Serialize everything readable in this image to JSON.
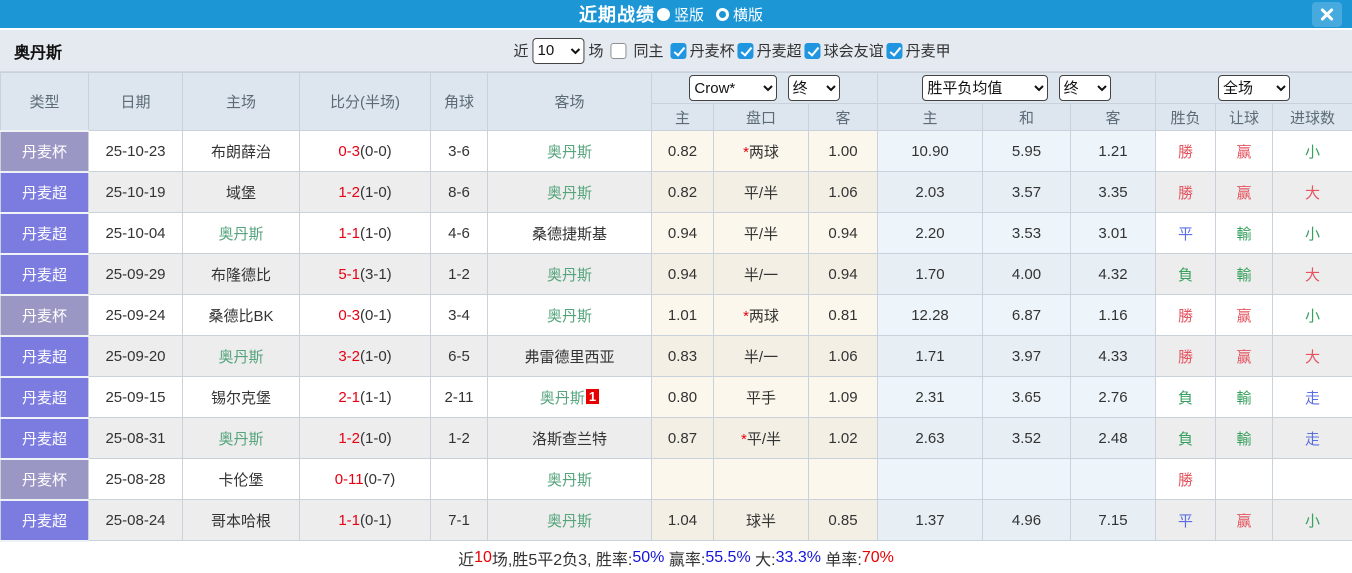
{
  "titlebar": {
    "title": "近期战绩",
    "view_options": [
      {
        "label": "竖版",
        "selected": true
      },
      {
        "label": "横版",
        "selected": false
      }
    ]
  },
  "filters": {
    "team": "奥丹斯",
    "recent_label": "近",
    "count_value": "10",
    "matches_label": "场",
    "same_home": {
      "label": "同主",
      "checked": false
    },
    "leagues": [
      {
        "label": "丹麦杯",
        "checked": true
      },
      {
        "label": "丹麦超",
        "checked": true
      },
      {
        "label": "球会友谊",
        "checked": true
      },
      {
        "label": "丹麦甲",
        "checked": true
      }
    ]
  },
  "controls": {
    "bookmaker": "Crow*",
    "bookmaker_state": "终",
    "europe": "胜平负均值",
    "europe_state": "终",
    "scope": "全场"
  },
  "table": {
    "headers": {
      "main": [
        "类型",
        "日期",
        "主场",
        "比分(半场)",
        "角球",
        "客场"
      ],
      "sub": [
        "主",
        "盘口",
        "客",
        "主",
        "和",
        "客",
        "胜负",
        "让球",
        "进球数"
      ]
    },
    "rows": [
      {
        "league": "丹麦杯",
        "league_type": "cup",
        "date": "25-10-23",
        "home": {
          "name": "布朗薛治",
          "self": false
        },
        "score_main": "0-3",
        "score_half": "(0-0)",
        "corner": "3-6",
        "away": {
          "name": "奥丹斯",
          "self": true
        },
        "asia": {
          "home": "0.82",
          "line": "两球",
          "star": true,
          "away": "1.00"
        },
        "euro": {
          "home": "10.90",
          "draw": "5.95",
          "away": "1.21"
        },
        "res": [
          {
            "t": "勝",
            "c": "red"
          },
          {
            "t": "赢",
            "c": "red"
          },
          {
            "t": "小",
            "c": "green"
          }
        ]
      },
      {
        "league": "丹麦超",
        "league_type": "super",
        "date": "25-10-19",
        "home": {
          "name": "域堡",
          "self": false
        },
        "score_main": "1-2",
        "score_half": "(1-0)",
        "corner": "8-6",
        "away": {
          "name": "奥丹斯",
          "self": true
        },
        "asia": {
          "home": "0.82",
          "line": "平/半",
          "star": false,
          "away": "1.06"
        },
        "euro": {
          "home": "2.03",
          "draw": "3.57",
          "away": "3.35"
        },
        "res": [
          {
            "t": "勝",
            "c": "red"
          },
          {
            "t": "赢",
            "c": "red"
          },
          {
            "t": "大",
            "c": "red"
          }
        ]
      },
      {
        "league": "丹麦超",
        "league_type": "super",
        "date": "25-10-04",
        "home": {
          "name": "奥丹斯",
          "self": true
        },
        "score_main": "1-1",
        "score_half": "(1-0)",
        "corner": "4-6",
        "away": {
          "name": "桑德捷斯基",
          "self": false
        },
        "asia": {
          "home": "0.94",
          "line": "平/半",
          "star": false,
          "away": "0.94"
        },
        "euro": {
          "home": "2.20",
          "draw": "3.53",
          "away": "3.01"
        },
        "res": [
          {
            "t": "平",
            "c": "blue"
          },
          {
            "t": "輸",
            "c": "green"
          },
          {
            "t": "小",
            "c": "green"
          }
        ]
      },
      {
        "league": "丹麦超",
        "league_type": "super",
        "date": "25-09-29",
        "home": {
          "name": "布隆德比",
          "self": false
        },
        "score_main": "5-1",
        "score_half": "(3-1)",
        "corner": "1-2",
        "away": {
          "name": "奥丹斯",
          "self": true
        },
        "asia": {
          "home": "0.94",
          "line": "半/一",
          "star": false,
          "away": "0.94"
        },
        "euro": {
          "home": "1.70",
          "draw": "4.00",
          "away": "4.32"
        },
        "res": [
          {
            "t": "負",
            "c": "green"
          },
          {
            "t": "輸",
            "c": "green"
          },
          {
            "t": "大",
            "c": "red"
          }
        ]
      },
      {
        "league": "丹麦杯",
        "league_type": "cup",
        "date": "25-09-24",
        "home": {
          "name": "桑德比BK",
          "self": false
        },
        "score_main": "0-3",
        "score_half": "(0-1)",
        "corner": "3-4",
        "away": {
          "name": "奥丹斯",
          "self": true
        },
        "asia": {
          "home": "1.01",
          "line": "两球",
          "star": true,
          "away": "0.81"
        },
        "euro": {
          "home": "12.28",
          "draw": "6.87",
          "away": "1.16"
        },
        "res": [
          {
            "t": "勝",
            "c": "red"
          },
          {
            "t": "赢",
            "c": "red"
          },
          {
            "t": "小",
            "c": "green"
          }
        ]
      },
      {
        "league": "丹麦超",
        "league_type": "super",
        "date": "25-09-20",
        "home": {
          "name": "奥丹斯",
          "self": true
        },
        "score_main": "3-2",
        "score_half": "(1-0)",
        "corner": "6-5",
        "away": {
          "name": "弗雷德里西亚",
          "self": false
        },
        "asia": {
          "home": "0.83",
          "line": "半/一",
          "star": false,
          "away": "1.06"
        },
        "euro": {
          "home": "1.71",
          "draw": "3.97",
          "away": "4.33"
        },
        "res": [
          {
            "t": "勝",
            "c": "red"
          },
          {
            "t": "赢",
            "c": "red"
          },
          {
            "t": "大",
            "c": "red"
          }
        ]
      },
      {
        "league": "丹麦超",
        "league_type": "super",
        "date": "25-09-15",
        "home": {
          "name": "锡尔克堡",
          "self": false
        },
        "score_main": "2-1",
        "score_half": "(1-1)",
        "corner": "2-11",
        "away": {
          "name": "奥丹斯",
          "self": true,
          "badge": "1"
        },
        "asia": {
          "home": "0.80",
          "line": "平手",
          "star": false,
          "away": "1.09"
        },
        "euro": {
          "home": "2.31",
          "draw": "3.65",
          "away": "2.76"
        },
        "res": [
          {
            "t": "負",
            "c": "green"
          },
          {
            "t": "輸",
            "c": "green"
          },
          {
            "t": "走",
            "c": "blue"
          }
        ]
      },
      {
        "league": "丹麦超",
        "league_type": "super",
        "date": "25-08-31",
        "home": {
          "name": "奥丹斯",
          "self": true
        },
        "score_main": "1-2",
        "score_half": "(1-0)",
        "corner": "1-2",
        "away": {
          "name": "洛斯查兰特",
          "self": false
        },
        "asia": {
          "home": "0.87",
          "line": "平/半",
          "star": true,
          "away": "1.02"
        },
        "euro": {
          "home": "2.63",
          "draw": "3.52",
          "away": "2.48"
        },
        "res": [
          {
            "t": "負",
            "c": "green"
          },
          {
            "t": "輸",
            "c": "green"
          },
          {
            "t": "走",
            "c": "blue"
          }
        ]
      },
      {
        "league": "丹麦杯",
        "league_type": "cup",
        "date": "25-08-28",
        "home": {
          "name": "卡伦堡",
          "self": false
        },
        "score_main": "0-11",
        "score_half": "(0-7)",
        "corner": "",
        "away": {
          "name": "奥丹斯",
          "self": true
        },
        "asia": {
          "home": "",
          "line": "",
          "star": false,
          "away": ""
        },
        "euro": {
          "home": "",
          "draw": "",
          "away": ""
        },
        "res": [
          {
            "t": "勝",
            "c": "red"
          },
          {
            "t": "",
            "c": "red"
          },
          {
            "t": "",
            "c": "red"
          }
        ]
      },
      {
        "league": "丹麦超",
        "league_type": "super",
        "date": "25-08-24",
        "home": {
          "name": "哥本哈根",
          "self": false
        },
        "score_main": "1-1",
        "score_half": "(0-1)",
        "corner": "7-1",
        "away": {
          "name": "奥丹斯",
          "self": true
        },
        "asia": {
          "home": "1.04",
          "line": "球半",
          "star": false,
          "away": "0.85"
        },
        "euro": {
          "home": "1.37",
          "draw": "4.96",
          "away": "7.15"
        },
        "res": [
          {
            "t": "平",
            "c": "blue"
          },
          {
            "t": "赢",
            "c": "red"
          },
          {
            "t": "小",
            "c": "green"
          }
        ]
      }
    ]
  },
  "summary": {
    "segments": [
      {
        "t": "近",
        "c": "dark"
      },
      {
        "t": "10",
        "c": "red"
      },
      {
        "t": "场,胜5平2负3, 胜率:",
        "c": "dark"
      },
      {
        "t": "50%",
        "c": "blue"
      },
      {
        "t": " 赢率:",
        "c": "dark"
      },
      {
        "t": "55.5%",
        "c": "blue"
      },
      {
        "t": " 大:",
        "c": "dark"
      },
      {
        "t": "33.3%",
        "c": "blue"
      },
      {
        "t": " 单率:",
        "c": "dark"
      },
      {
        "t": "70%",
        "c": "red"
      }
    ]
  },
  "colors": {
    "titlebar_blue": "#1c96d5",
    "badge_cup": "#9a97c4",
    "badge_super": "#7c7be0",
    "score_red": "#e60012",
    "self_team_green": "#55a47c",
    "result_red": "#e45560",
    "result_green": "#37a05e",
    "result_blue": "#5b6ee1",
    "checkbox_blue": "#2196e0"
  }
}
